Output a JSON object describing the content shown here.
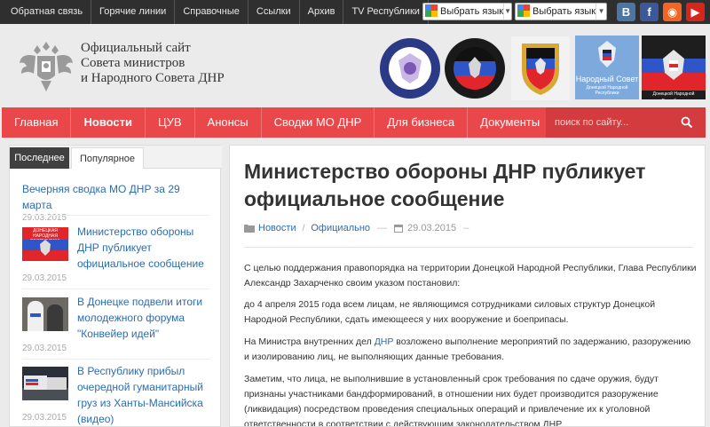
{
  "topbar": {
    "links": [
      "Обратная связь",
      "Горячие линии",
      "Справочные",
      "Ссылки",
      "Архив",
      "TV Республики"
    ],
    "lang_selectors": [
      "Выбрать язык",
      "Выбрать язык"
    ],
    "social": [
      {
        "name": "vk",
        "glyph": "B",
        "color": "#4c75a3"
      },
      {
        "name": "facebook",
        "glyph": "f",
        "color": "#3b5998"
      },
      {
        "name": "rss",
        "glyph": "◉",
        "color": "#f26522"
      },
      {
        "name": "youtube",
        "glyph": "▶",
        "color": "#d8251c"
      }
    ]
  },
  "header": {
    "title_lines": [
      "Официальный сайт",
      "Совета министров",
      "и Народного Совета ДНР"
    ],
    "banners": {
      "b4_line1": "Народный Совет",
      "b4_line2": "Донецкой Народной Республики",
      "b5_line": "Донецкой Народной Республики"
    }
  },
  "nav": {
    "items": [
      "Главная",
      "Новости",
      "ЦУВ",
      "Анонсы",
      "Сводки МО ДНР",
      "Для бизнеса",
      "Документы"
    ],
    "active_index": 1,
    "search_placeholder": "поиск по сайту..."
  },
  "sidebar": {
    "tabs": [
      "Последнее",
      "Популярное"
    ],
    "items": [
      {
        "title": "Вечерняя сводка МО ДНР за 29 марта",
        "date": "29.03.2015",
        "thumb": "none"
      },
      {
        "title": "Министерство обороны ДНР публикует официальное сообщение",
        "date": "29.03.2015",
        "thumb": "flag",
        "thumb_text": "ДОНЕЦКАЯ НАРОДНАЯ РЕСПУБЛИКА"
      },
      {
        "title": "В Донецке подвели итоги молодежного форума \"Конвейер идей\"",
        "date": "29.03.2015",
        "thumb": "photo"
      },
      {
        "title": "В Республику прибыл очередной гуманитарный груз из Ханты-Мансийска (видео)",
        "date": "29.03.2015",
        "thumb": "trucks"
      }
    ]
  },
  "article": {
    "title": "Министерство обороны ДНР публикует официальное сообщение",
    "category": "Новости",
    "subcategory": "Официально",
    "date": "29.03.2015",
    "p1": "С целью поддержания правопорядка на территории Донецкой Народной Республики, Глава Республики Александр Захарченко своим указом постановил:",
    "p2": "до 4 апреля 2015 года всем лицам, не являющимся сотрудниками силовых структур Донецкой Народной Республики, сдать имеющееся у них вооружение и боеприпасы.",
    "p3_before": "На Министра внутренних дел ",
    "p3_link": "ДНР",
    "p3_after": " возложено выполнение мероприятий по задержанию, разоружению и изолированию лиц, не выполняющих данные требования.",
    "p4": "Заметим, что лица, не выполнившие в установленный срок требования по сдаче оружия, будут признаны участниками бандформирований, в отношении них будет производится разоружение (ликвидация) посредством проведения специальных операций и привлечение их к уголовной ответственности в соответствии с действующим законодательством ДНР."
  }
}
